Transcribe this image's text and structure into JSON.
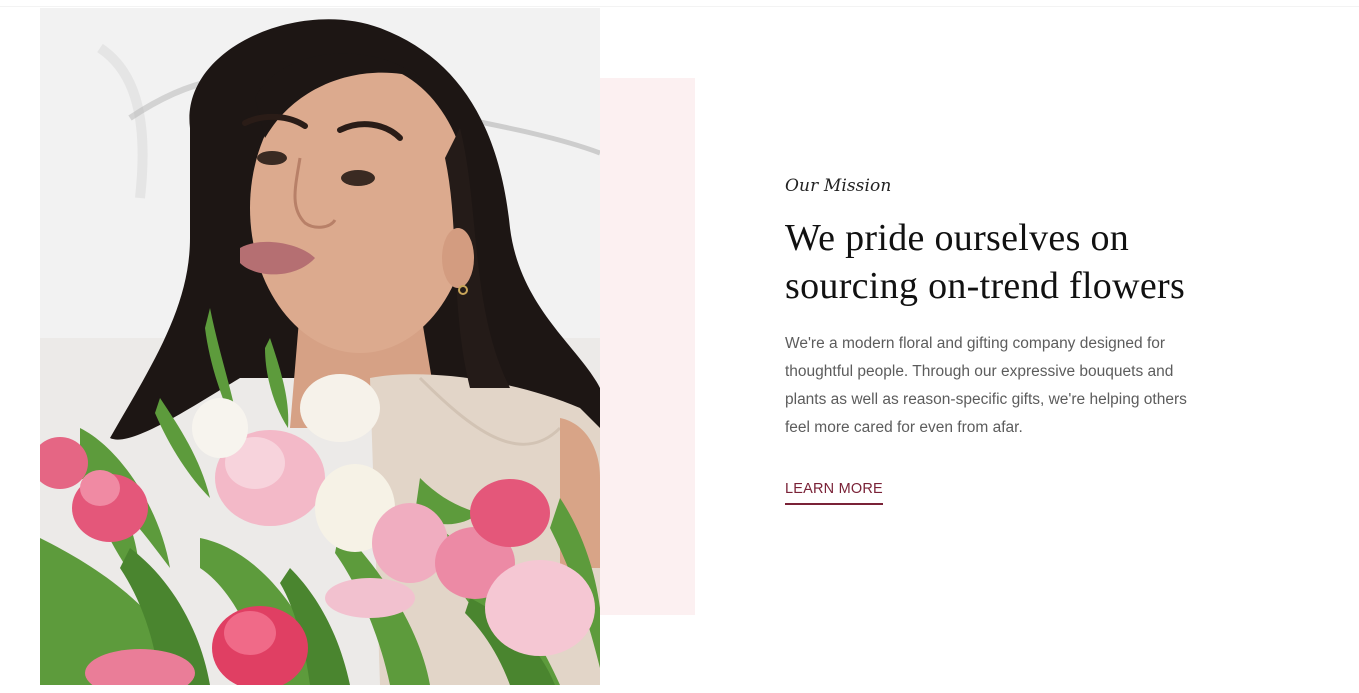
{
  "mission": {
    "eyebrow": "Our Mission",
    "headline_line1": "We pride ourselves on",
    "headline_line2": "sourcing on-trend flowers",
    "body": "We're a modern floral and gifting company designed for thoughtful people. Through our expressive bouquets and plants as well as reason-specific gifts, we're helping others feel more cared for even from afar.",
    "cta_label": "LEARN MORE"
  },
  "colors": {
    "accent": "#7a2237",
    "panel_pink": "#fcf0f1",
    "headline": "#111111",
    "body_text": "#5c5c5c"
  }
}
